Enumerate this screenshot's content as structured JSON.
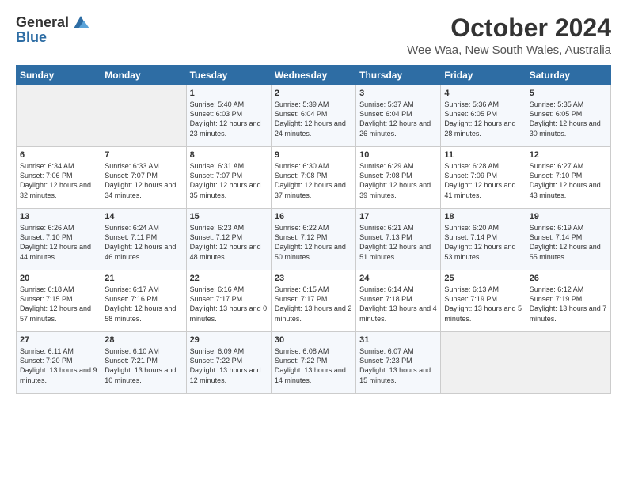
{
  "header": {
    "logo_general": "General",
    "logo_blue": "Blue",
    "month_title": "October 2024",
    "location": "Wee Waa, New South Wales, Australia"
  },
  "days_of_week": [
    "Sunday",
    "Monday",
    "Tuesday",
    "Wednesday",
    "Thursday",
    "Friday",
    "Saturday"
  ],
  "weeks": [
    [
      {
        "day": "",
        "empty": true
      },
      {
        "day": "",
        "empty": true
      },
      {
        "day": "1",
        "sunrise": "Sunrise: 5:40 AM",
        "sunset": "Sunset: 6:03 PM",
        "daylight": "Daylight: 12 hours and 23 minutes."
      },
      {
        "day": "2",
        "sunrise": "Sunrise: 5:39 AM",
        "sunset": "Sunset: 6:04 PM",
        "daylight": "Daylight: 12 hours and 24 minutes."
      },
      {
        "day": "3",
        "sunrise": "Sunrise: 5:37 AM",
        "sunset": "Sunset: 6:04 PM",
        "daylight": "Daylight: 12 hours and 26 minutes."
      },
      {
        "day": "4",
        "sunrise": "Sunrise: 5:36 AM",
        "sunset": "Sunset: 6:05 PM",
        "daylight": "Daylight: 12 hours and 28 minutes."
      },
      {
        "day": "5",
        "sunrise": "Sunrise: 5:35 AM",
        "sunset": "Sunset: 6:05 PM",
        "daylight": "Daylight: 12 hours and 30 minutes."
      }
    ],
    [
      {
        "day": "6",
        "sunrise": "Sunrise: 6:34 AM",
        "sunset": "Sunset: 7:06 PM",
        "daylight": "Daylight: 12 hours and 32 minutes."
      },
      {
        "day": "7",
        "sunrise": "Sunrise: 6:33 AM",
        "sunset": "Sunset: 7:07 PM",
        "daylight": "Daylight: 12 hours and 34 minutes."
      },
      {
        "day": "8",
        "sunrise": "Sunrise: 6:31 AM",
        "sunset": "Sunset: 7:07 PM",
        "daylight": "Daylight: 12 hours and 35 minutes."
      },
      {
        "day": "9",
        "sunrise": "Sunrise: 6:30 AM",
        "sunset": "Sunset: 7:08 PM",
        "daylight": "Daylight: 12 hours and 37 minutes."
      },
      {
        "day": "10",
        "sunrise": "Sunrise: 6:29 AM",
        "sunset": "Sunset: 7:08 PM",
        "daylight": "Daylight: 12 hours and 39 minutes."
      },
      {
        "day": "11",
        "sunrise": "Sunrise: 6:28 AM",
        "sunset": "Sunset: 7:09 PM",
        "daylight": "Daylight: 12 hours and 41 minutes."
      },
      {
        "day": "12",
        "sunrise": "Sunrise: 6:27 AM",
        "sunset": "Sunset: 7:10 PM",
        "daylight": "Daylight: 12 hours and 43 minutes."
      }
    ],
    [
      {
        "day": "13",
        "sunrise": "Sunrise: 6:26 AM",
        "sunset": "Sunset: 7:10 PM",
        "daylight": "Daylight: 12 hours and 44 minutes."
      },
      {
        "day": "14",
        "sunrise": "Sunrise: 6:24 AM",
        "sunset": "Sunset: 7:11 PM",
        "daylight": "Daylight: 12 hours and 46 minutes."
      },
      {
        "day": "15",
        "sunrise": "Sunrise: 6:23 AM",
        "sunset": "Sunset: 7:12 PM",
        "daylight": "Daylight: 12 hours and 48 minutes."
      },
      {
        "day": "16",
        "sunrise": "Sunrise: 6:22 AM",
        "sunset": "Sunset: 7:12 PM",
        "daylight": "Daylight: 12 hours and 50 minutes."
      },
      {
        "day": "17",
        "sunrise": "Sunrise: 6:21 AM",
        "sunset": "Sunset: 7:13 PM",
        "daylight": "Daylight: 12 hours and 51 minutes."
      },
      {
        "day": "18",
        "sunrise": "Sunrise: 6:20 AM",
        "sunset": "Sunset: 7:14 PM",
        "daylight": "Daylight: 12 hours and 53 minutes."
      },
      {
        "day": "19",
        "sunrise": "Sunrise: 6:19 AM",
        "sunset": "Sunset: 7:14 PM",
        "daylight": "Daylight: 12 hours and 55 minutes."
      }
    ],
    [
      {
        "day": "20",
        "sunrise": "Sunrise: 6:18 AM",
        "sunset": "Sunset: 7:15 PM",
        "daylight": "Daylight: 12 hours and 57 minutes."
      },
      {
        "day": "21",
        "sunrise": "Sunrise: 6:17 AM",
        "sunset": "Sunset: 7:16 PM",
        "daylight": "Daylight: 12 hours and 58 minutes."
      },
      {
        "day": "22",
        "sunrise": "Sunrise: 6:16 AM",
        "sunset": "Sunset: 7:17 PM",
        "daylight": "Daylight: 13 hours and 0 minutes."
      },
      {
        "day": "23",
        "sunrise": "Sunrise: 6:15 AM",
        "sunset": "Sunset: 7:17 PM",
        "daylight": "Daylight: 13 hours and 2 minutes."
      },
      {
        "day": "24",
        "sunrise": "Sunrise: 6:14 AM",
        "sunset": "Sunset: 7:18 PM",
        "daylight": "Daylight: 13 hours and 4 minutes."
      },
      {
        "day": "25",
        "sunrise": "Sunrise: 6:13 AM",
        "sunset": "Sunset: 7:19 PM",
        "daylight": "Daylight: 13 hours and 5 minutes."
      },
      {
        "day": "26",
        "sunrise": "Sunrise: 6:12 AM",
        "sunset": "Sunset: 7:19 PM",
        "daylight": "Daylight: 13 hours and 7 minutes."
      }
    ],
    [
      {
        "day": "27",
        "sunrise": "Sunrise: 6:11 AM",
        "sunset": "Sunset: 7:20 PM",
        "daylight": "Daylight: 13 hours and 9 minutes."
      },
      {
        "day": "28",
        "sunrise": "Sunrise: 6:10 AM",
        "sunset": "Sunset: 7:21 PM",
        "daylight": "Daylight: 13 hours and 10 minutes."
      },
      {
        "day": "29",
        "sunrise": "Sunrise: 6:09 AM",
        "sunset": "Sunset: 7:22 PM",
        "daylight": "Daylight: 13 hours and 12 minutes."
      },
      {
        "day": "30",
        "sunrise": "Sunrise: 6:08 AM",
        "sunset": "Sunset: 7:22 PM",
        "daylight": "Daylight: 13 hours and 14 minutes."
      },
      {
        "day": "31",
        "sunrise": "Sunrise: 6:07 AM",
        "sunset": "Sunset: 7:23 PM",
        "daylight": "Daylight: 13 hours and 15 minutes."
      },
      {
        "day": "",
        "empty": true
      },
      {
        "day": "",
        "empty": true
      }
    ]
  ]
}
